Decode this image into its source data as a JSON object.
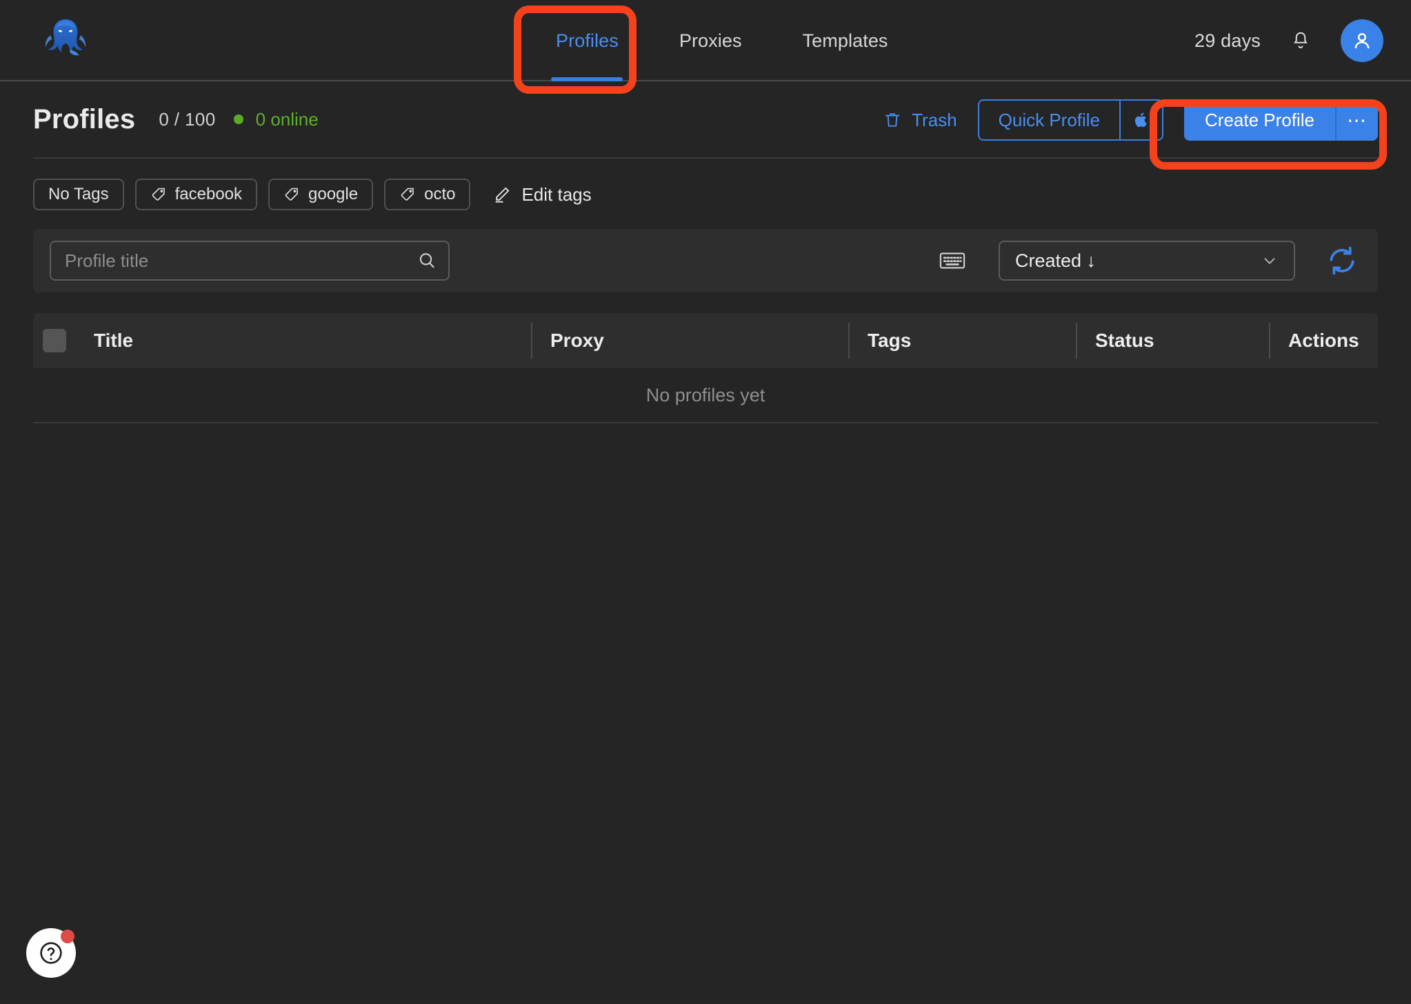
{
  "app": {
    "logo_name": "octo-browser-logo",
    "background": "#252525",
    "accent_blue": "#3b82e8",
    "annotation_color": "#F4431C"
  },
  "header": {
    "nav": [
      {
        "label": "Profiles",
        "active": true
      },
      {
        "label": "Proxies",
        "active": false
      },
      {
        "label": "Templates",
        "active": false
      }
    ],
    "days_remaining": "29 days",
    "bell_icon": "bell-icon",
    "avatar_icon": "user-icon"
  },
  "page": {
    "title": "Profiles",
    "counter": "0 / 100",
    "online_status": "0 online",
    "online_color": "#5fae2b"
  },
  "actions": {
    "trash_label": "Trash",
    "trash_icon": "trash-icon",
    "quick_profile_label": "Quick Profile",
    "quick_profile_os_icon": "apple-icon",
    "create_profile_label": "Create Profile",
    "create_profile_more": "⋯"
  },
  "tags": {
    "chips": [
      {
        "label": "No Tags",
        "icon": null
      },
      {
        "label": "facebook",
        "icon": "tag-icon"
      },
      {
        "label": "google",
        "icon": "tag-icon"
      },
      {
        "label": "octo",
        "icon": "tag-icon"
      }
    ],
    "edit_label": "Edit tags",
    "edit_icon": "pencil-icon"
  },
  "toolbar": {
    "search_placeholder": "Profile title",
    "search_value": "",
    "search_icon": "search-icon",
    "keyboard_icon": "keyboard-icon",
    "sort_label": "Created ↓",
    "sort_chevron": "chevron-down-icon",
    "refresh_icon": "refresh-icon"
  },
  "table": {
    "columns": [
      {
        "label": "Title"
      },
      {
        "label": "Proxy"
      },
      {
        "label": "Tags"
      },
      {
        "label": "Status"
      },
      {
        "label": "Actions"
      }
    ],
    "rows": [],
    "empty_message": "No profiles yet"
  },
  "help": {
    "icon": "question-mark-icon",
    "has_notification": true
  }
}
